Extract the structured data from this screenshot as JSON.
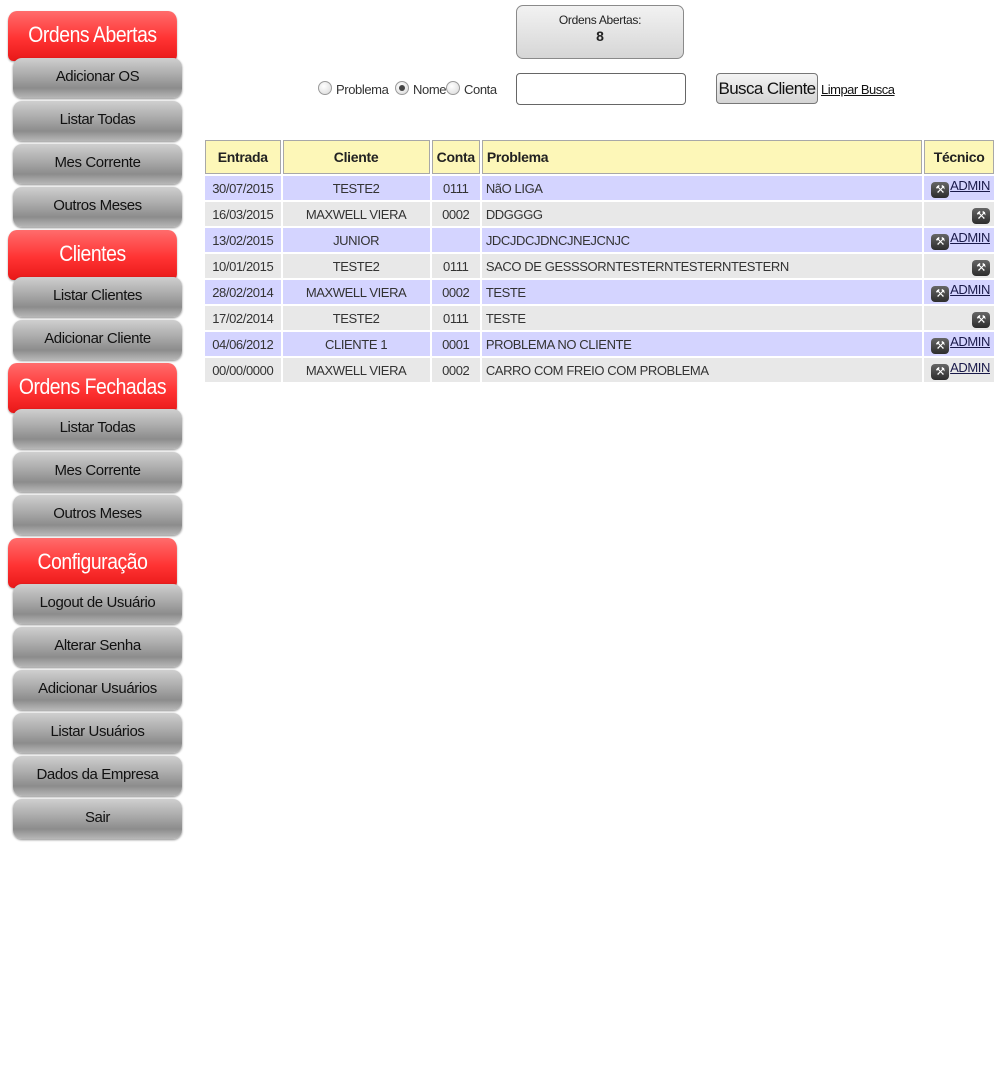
{
  "sidebar": {
    "sections": [
      {
        "title": "Ordens Abertas",
        "items": [
          "Adicionar OS",
          "Listar Todas",
          "Mes Corrente",
          "Outros Meses"
        ]
      },
      {
        "title": "Clientes",
        "items": [
          "Listar Clientes",
          "Adicionar Cliente"
        ]
      },
      {
        "title": "Ordens Fechadas",
        "items": [
          "Listar Todas",
          "Mes Corrente",
          "Outros Meses"
        ]
      },
      {
        "title": "Configuração",
        "items": [
          "Logout de Usuário",
          "Alterar Senha",
          "Adicionar Usuários",
          "Listar Usuários",
          "Dados da Empresa",
          "Sair"
        ]
      }
    ]
  },
  "counter": {
    "label": "Ordens Abertas:",
    "value": "8"
  },
  "search": {
    "options": [
      "Problema",
      "Nome",
      "Conta"
    ],
    "selected": "Nome",
    "value": "",
    "button": "Busca Cliente",
    "clear": "Limpar Busca"
  },
  "table": {
    "headers": [
      "Entrada",
      "Cliente",
      "Conta",
      "Problema",
      "Técnico"
    ],
    "rows": [
      {
        "entrada": "30/07/2015",
        "cliente": "TESTE2",
        "conta": "0111",
        "problema": "NãO LIGA",
        "tecnico": "ADMIN"
      },
      {
        "entrada": "16/03/2015",
        "cliente": "MAXWELL VIERA",
        "conta": "0002",
        "problema": "DDGGGG",
        "tecnico": ""
      },
      {
        "entrada": "13/02/2015",
        "cliente": "JUNIOR",
        "conta": "",
        "problema": "JDCJDCJDNCJNEJCNJC",
        "tecnico": "ADMIN"
      },
      {
        "entrada": "10/01/2015",
        "cliente": "TESTE2",
        "conta": "0111",
        "problema": "SACO DE GESSSORNTESTERNTESTERNTESTERN",
        "tecnico": ""
      },
      {
        "entrada": "28/02/2014",
        "cliente": "MAXWELL VIERA",
        "conta": "0002",
        "problema": "TESTE",
        "tecnico": "ADMIN"
      },
      {
        "entrada": "17/02/2014",
        "cliente": "TESTE2",
        "conta": "0111",
        "problema": "TESTE",
        "tecnico": ""
      },
      {
        "entrada": "04/06/2012",
        "cliente": "CLIENTE 1",
        "conta": "0001",
        "problema": "PROBLEMA NO CLIENTE",
        "tecnico": "ADMIN"
      },
      {
        "entrada": "00/00/0000",
        "cliente": "MAXWELL VIERA",
        "conta": "0002",
        "problema": "CARRO COM FREIO COM PROBLEMA",
        "tecnico": "ADMIN"
      }
    ]
  },
  "icons": {
    "assign": "wrench-icon"
  },
  "colors": {
    "section_header": "#ff3333",
    "menu_button": "#a8a8a8",
    "table_header": "#fdf7b8",
    "row_odd": "#d4d4ff",
    "row_even": "#e8e8e8"
  }
}
